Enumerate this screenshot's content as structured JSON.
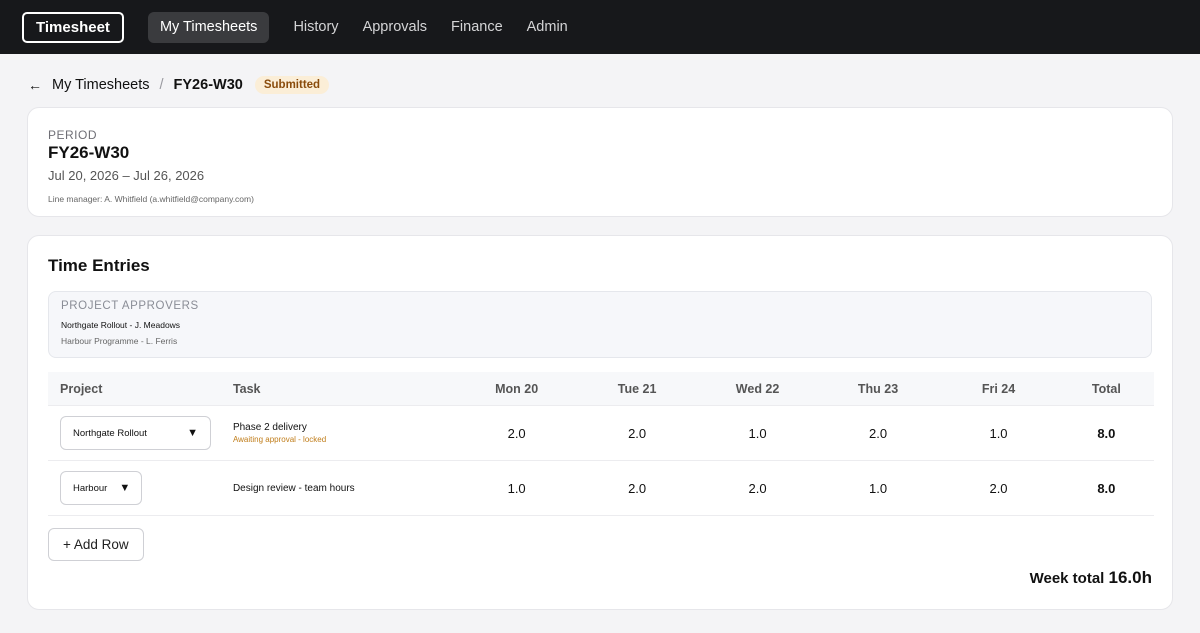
{
  "nav": {
    "brand": "Timesheet",
    "items": [
      "My Timesheets",
      "History",
      "Approvals",
      "Finance",
      "Admin"
    ]
  },
  "breadcrumb": {
    "back": "←",
    "parent": "My Timesheets",
    "separator": "/",
    "current": "FY26-W30",
    "status": "Submitted"
  },
  "period": {
    "label": "PERIOD",
    "title": "FY26-W30",
    "dates": "Jul 20, 2026 – Jul 26, 2026",
    "manager": "Line manager: A. Whitfield (a.whitfield@company.com)"
  },
  "entries": {
    "title": "Time Entries",
    "approvers_title": "PROJECT APPROVERS",
    "approvers": [
      "Northgate Rollout - J. Meadows",
      "Harbour Programme - L. Ferris"
    ],
    "columns": [
      "Project",
      "Task",
      "Mon 20",
      "Tue 21",
      "Wed 22",
      "Thu 23",
      "Fri 24",
      "Total"
    ],
    "rows": [
      {
        "project": "Northgate Rollout",
        "task": "Phase 2 delivery",
        "task_note": "Awaiting approval - locked",
        "days": [
          "2.0",
          "2.0",
          "1.0",
          "2.0",
          "1.0"
        ],
        "total": "8.0"
      },
      {
        "project": "Harbour",
        "task": "Design review - team hours",
        "task_note": "",
        "days": [
          "1.0",
          "2.0",
          "2.0",
          "1.0",
          "2.0"
        ],
        "total": "8.0"
      }
    ],
    "add_row": "+ Add Row",
    "week_total_label": "Week total",
    "week_total_value": "16.0h"
  },
  "colors": {
    "nav_bg": "#17181b",
    "badge_bg": "#fbeed7",
    "badge_text": "#8a4c0c",
    "warning_text": "#c07d1a"
  },
  "icons": {
    "back": "back-arrow-icon",
    "dropdown": "chevron-down-icon"
  }
}
